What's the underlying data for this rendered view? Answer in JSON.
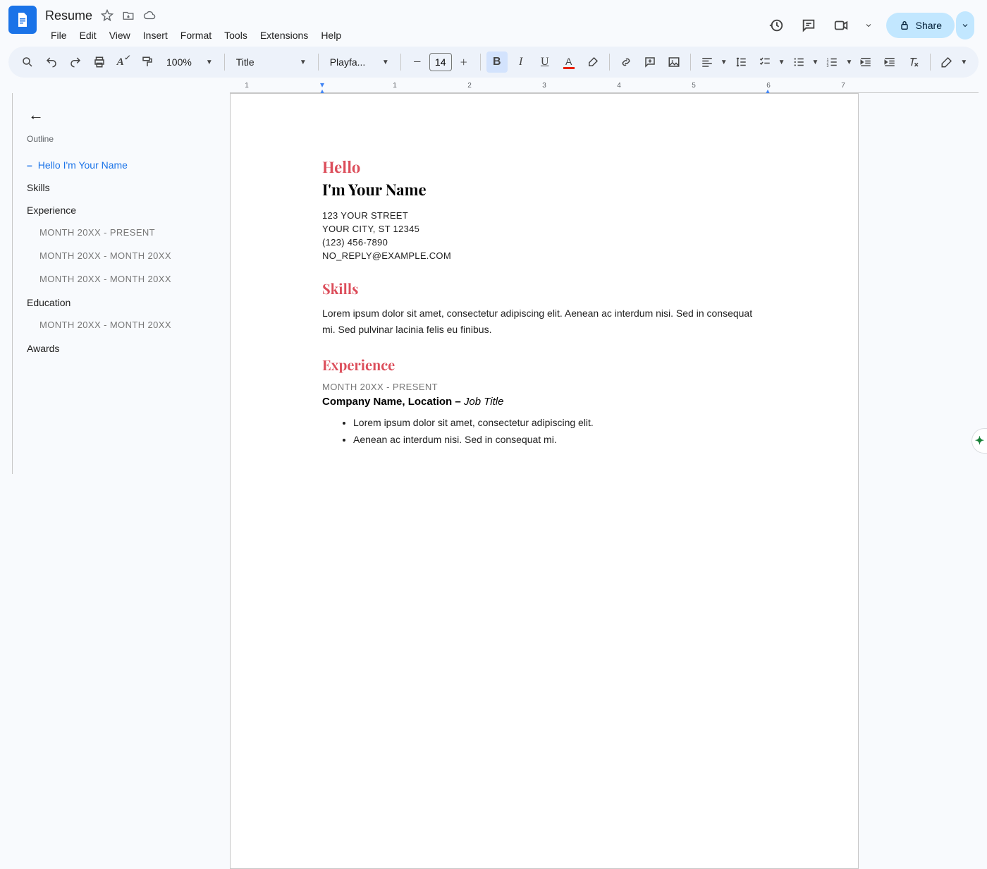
{
  "header": {
    "doc_title": "Resume",
    "menus": [
      "File",
      "Edit",
      "View",
      "Insert",
      "Format",
      "Tools",
      "Extensions",
      "Help"
    ],
    "share_label": "Share"
  },
  "toolbar": {
    "zoom": "100%",
    "style": "Title",
    "font": "Playfa...",
    "font_size": "14"
  },
  "ruler": {
    "marks": [
      "1",
      "1",
      "2",
      "3",
      "4",
      "5",
      "6",
      "7"
    ]
  },
  "outline": {
    "title": "Outline",
    "items": [
      {
        "label": "Hello I'm Your Name",
        "sel": true,
        "sub": false
      },
      {
        "label": "Skills",
        "sel": false,
        "sub": false
      },
      {
        "label": "Experience",
        "sel": false,
        "sub": false
      },
      {
        "label": "MONTH 20XX - PRESENT",
        "sel": false,
        "sub": true
      },
      {
        "label": "MONTH 20XX - MONTH 20XX",
        "sel": false,
        "sub": true
      },
      {
        "label": "MONTH 20XX - MONTH 20XX",
        "sel": false,
        "sub": true
      },
      {
        "label": "Education",
        "sel": false,
        "sub": false
      },
      {
        "label": "MONTH 20XX - MONTH 20XX",
        "sel": false,
        "sub": true
      },
      {
        "label": "Awards",
        "sel": false,
        "sub": false
      }
    ]
  },
  "doc": {
    "hello": "Hello",
    "name": "I'm Your Name",
    "street": "123 YOUR STREET",
    "city": "YOUR CITY, ST 12345",
    "phone": "(123) 456-7890",
    "email": "NO_REPLY@EXAMPLE.COM",
    "skills_h": "Skills",
    "skills_body": "Lorem ipsum dolor sit amet, consectetur adipiscing elit. Aenean ac interdum nisi. Sed in consequat mi. Sed pulvinar lacinia felis eu finibus.",
    "exp_h": "Experience",
    "exp_date": "MONTH 20XX - PRESENT",
    "exp_company": "Company Name, Location",
    "exp_sep": " – ",
    "exp_title": "Job Title",
    "bullets": [
      "Lorem ipsum dolor sit amet, consectetur adipiscing elit.",
      "Aenean ac interdum nisi. Sed in consequat mi."
    ]
  }
}
